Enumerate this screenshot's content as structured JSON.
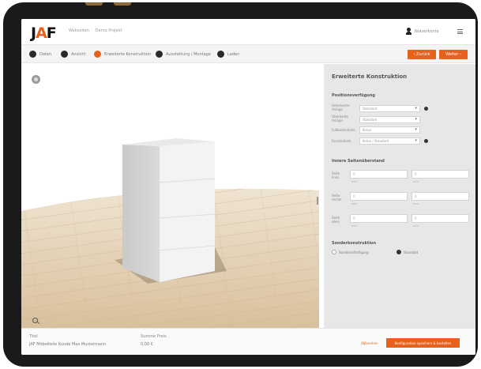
{
  "header": {
    "logo": "JAF",
    "breadcrumb": [
      "Webseiten",
      "Demo Projekt"
    ],
    "user_name": "Nutzerkonto"
  },
  "steps": [
    {
      "label": "Daten"
    },
    {
      "label": "Ansicht"
    },
    {
      "label": "Erweiterte Konstruktion"
    },
    {
      "label": "Ausstattung / Montage"
    },
    {
      "label": "Laden"
    }
  ],
  "actions": {
    "back": "‹ Zurück",
    "next": "Weiter ›"
  },
  "panel": {
    "title": "Erweiterte Konstruktion",
    "section1": "Positionsverfügung",
    "fields": [
      {
        "label": "Unterkante Anlage",
        "value": "Standard"
      },
      {
        "label": "Oberkante Anlage",
        "value": "Standard"
      },
      {
        "label": "Fußbodenhöhe",
        "value": "Keine"
      },
      {
        "label": "Fensterbank",
        "value": "Keine / Standard"
      }
    ],
    "section2": "Innere Seitenüberstand",
    "rows": [
      {
        "label": "Seite links",
        "a": "0",
        "b": "0",
        "a_sub": "mm",
        "b_sub": "mm"
      },
      {
        "label": "Seite rechts",
        "a": "0",
        "b": "0",
        "a_sub": "mm",
        "b_sub": "mm"
      },
      {
        "label": "Seite oben",
        "a": "0",
        "b": "0",
        "a_sub": "mm",
        "b_sub": "mm"
      }
    ],
    "section3": "Sonderkonstruktion",
    "options": [
      "Sonderanfertigung",
      "Standard"
    ]
  },
  "footer": {
    "title_label": "Titel",
    "title_value": "JAF Möbelteile Kunde Max Mustermann",
    "price_label": "Summe Preis",
    "price_value": "0,00 €",
    "link": "Abbrechen",
    "button": "Konfiguration speichern & bestellen"
  }
}
